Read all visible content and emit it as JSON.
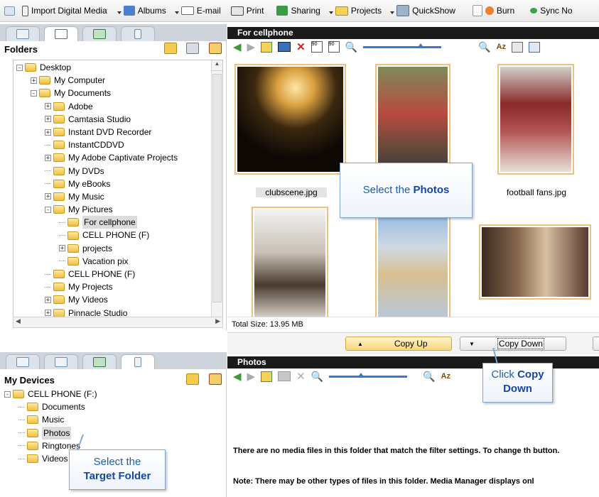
{
  "toolbar": {
    "items": [
      {
        "label": "Import Digital Media",
        "icon": "import-icon"
      },
      {
        "label": "Albums",
        "icon": "albums-icon"
      },
      {
        "label": "E-mail",
        "icon": "email-icon"
      },
      {
        "label": "Print",
        "icon": "print-icon"
      },
      {
        "label": "Sharing",
        "icon": "sharing-icon"
      },
      {
        "label": "Projects",
        "icon": "projects-icon"
      },
      {
        "label": "QuickShow",
        "icon": "quickshow-icon"
      },
      {
        "label": "Burn",
        "icon": "burn-icon"
      },
      {
        "label": "Sync No",
        "icon": "sync-icon"
      }
    ]
  },
  "folders_pane": {
    "title": "Folders",
    "tree": [
      {
        "label": "Desktop",
        "level": 0,
        "expander": "-"
      },
      {
        "label": "My Computer",
        "level": 1,
        "expander": "+"
      },
      {
        "label": "My Documents",
        "level": 1,
        "expander": "-"
      },
      {
        "label": "Adobe",
        "level": 2,
        "expander": "+"
      },
      {
        "label": "Camtasia Studio",
        "level": 2,
        "expander": "+"
      },
      {
        "label": "Instant DVD Recorder",
        "level": 2,
        "expander": "+"
      },
      {
        "label": "InstantCDDVD",
        "level": 2,
        "expander": ""
      },
      {
        "label": "My Adobe Captivate Projects",
        "level": 2,
        "expander": "+"
      },
      {
        "label": "My DVDs",
        "level": 2,
        "expander": ""
      },
      {
        "label": "My eBooks",
        "level": 2,
        "expander": ""
      },
      {
        "label": "My Music",
        "level": 2,
        "expander": "+"
      },
      {
        "label": "My Pictures",
        "level": 2,
        "expander": "-"
      },
      {
        "label": "For cellphone",
        "level": 3,
        "expander": "",
        "selected": true
      },
      {
        "label": "CELL PHONE (F)",
        "level": 3,
        "expander": ""
      },
      {
        "label": "projects",
        "level": 3,
        "expander": "+"
      },
      {
        "label": "Vacation pix",
        "level": 3,
        "expander": ""
      },
      {
        "label": "CELL PHONE (F)",
        "level": 2,
        "expander": ""
      },
      {
        "label": "My Projects",
        "level": 2,
        "expander": ""
      },
      {
        "label": "My Videos",
        "level": 2,
        "expander": "+"
      },
      {
        "label": "Pinnacle Studio",
        "level": 2,
        "expander": "+"
      }
    ]
  },
  "devices_pane": {
    "title": "My Devices",
    "tree": [
      {
        "label": "CELL PHONE (F:)",
        "level": 0,
        "expander": "-"
      },
      {
        "label": "Documents",
        "level": 1,
        "expander": ""
      },
      {
        "label": "Music",
        "level": 1,
        "expander": ""
      },
      {
        "label": "Photos",
        "level": 1,
        "expander": "",
        "selected": true
      },
      {
        "label": "Ringtones",
        "level": 1,
        "expander": ""
      },
      {
        "label": "Videos",
        "level": 1,
        "expander": ""
      }
    ]
  },
  "upper_view": {
    "title": "For cellphone",
    "captions": [
      "clubscene.jpg",
      "football fans.jpg"
    ],
    "total_size": "Total Size: 13.95 MB"
  },
  "copy_buttons": {
    "up": "Copy Up",
    "down": "Copy Down"
  },
  "lower_view": {
    "title": "Photos",
    "message": "There are no media files in this folder that match the filter settings. To change th button.",
    "note": "Note: There may be other types of files in this folder. Media Manager displays onl"
  },
  "callouts": {
    "photos": {
      "text": "Select the ",
      "bold": "Photos"
    },
    "copy_down": {
      "text": "Click ",
      "bold": "Copy",
      "bold2": "Down"
    },
    "target": {
      "text": "Select the",
      "bold": "Target Folder"
    }
  }
}
